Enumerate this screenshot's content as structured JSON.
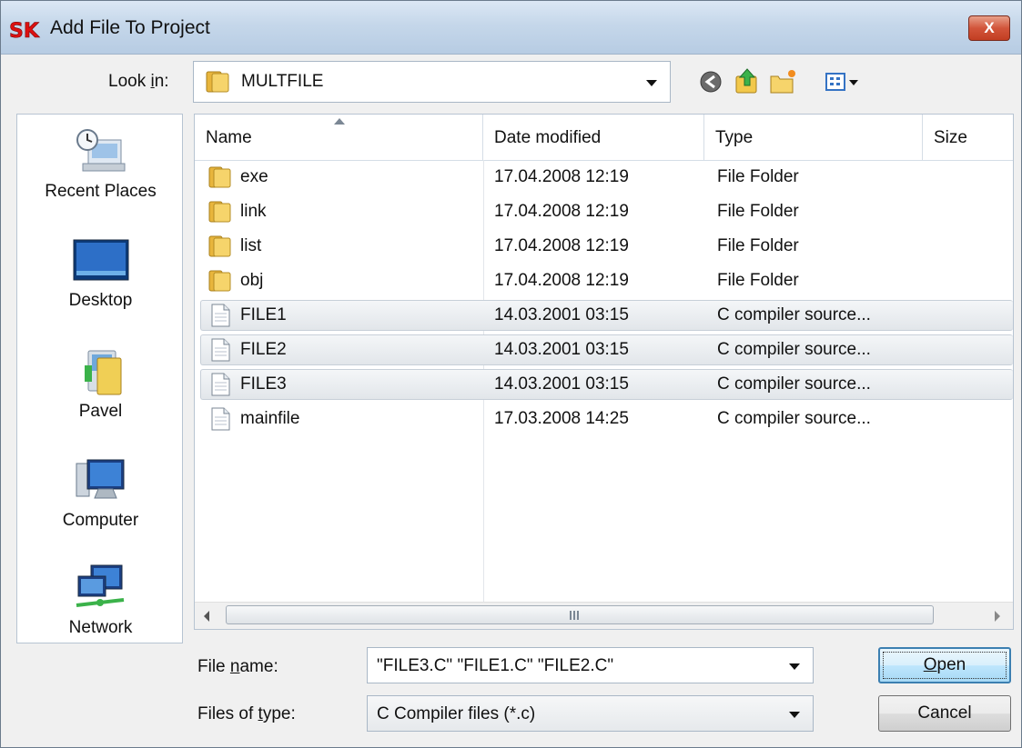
{
  "window": {
    "title": "Add File To Project",
    "app_icon": "sk-logo-icon",
    "close_label": "X"
  },
  "look_in": {
    "label_pre": "Look ",
    "label_key": "i",
    "label_post": "n:",
    "value": "MULTFILE"
  },
  "toolbar": {
    "icons": [
      "back-icon",
      "up-folder-icon",
      "new-folder-icon",
      "views-menu-icon"
    ]
  },
  "places": [
    {
      "label": "Recent Places",
      "icon": "recent-places-icon"
    },
    {
      "label": "Desktop",
      "icon": "desktop-icon"
    },
    {
      "label": "Pavel",
      "icon": "user-folder-icon"
    },
    {
      "label": "Computer",
      "icon": "computer-icon"
    },
    {
      "label": "Network",
      "icon": "network-icon"
    }
  ],
  "columns": {
    "name": "Name",
    "date": "Date modified",
    "type": "Type",
    "size": "Size"
  },
  "files": [
    {
      "name": "exe",
      "date": "17.04.2008 12:19",
      "type": "File Folder",
      "icon": "folder-icon"
    },
    {
      "name": "link",
      "date": "17.04.2008 12:19",
      "type": "File Folder",
      "icon": "folder-icon"
    },
    {
      "name": "list",
      "date": "17.04.2008 12:19",
      "type": "File Folder",
      "icon": "folder-icon"
    },
    {
      "name": "obj",
      "date": "17.04.2008 12:19",
      "type": "File Folder",
      "icon": "folder-icon"
    },
    {
      "name": "FILE1",
      "date": "14.03.2001 03:15",
      "type": "C compiler source...",
      "icon": "file-icon",
      "selected": true
    },
    {
      "name": "FILE2",
      "date": "14.03.2001 03:15",
      "type": "C compiler source...",
      "icon": "file-icon",
      "selected": true
    },
    {
      "name": "FILE3",
      "date": "14.03.2001 03:15",
      "type": "C compiler source...",
      "icon": "file-icon",
      "selected": true
    },
    {
      "name": "mainfile",
      "date": "17.03.2008 14:25",
      "type": "C compiler source...",
      "icon": "file-icon"
    }
  ],
  "scrollbar": {
    "grip": "III"
  },
  "file_name": {
    "label_pre": "File ",
    "label_key": "n",
    "label_post": "ame:",
    "value": "\"FILE3.C\" \"FILE1.C\" \"FILE2.C\""
  },
  "file_type": {
    "label_pre": "Files of ",
    "label_key": "t",
    "label_post": "ype:",
    "value": "C Compiler files (*.c)"
  },
  "buttons": {
    "open_key": "O",
    "open_rest": "pen",
    "cancel": "Cancel"
  }
}
